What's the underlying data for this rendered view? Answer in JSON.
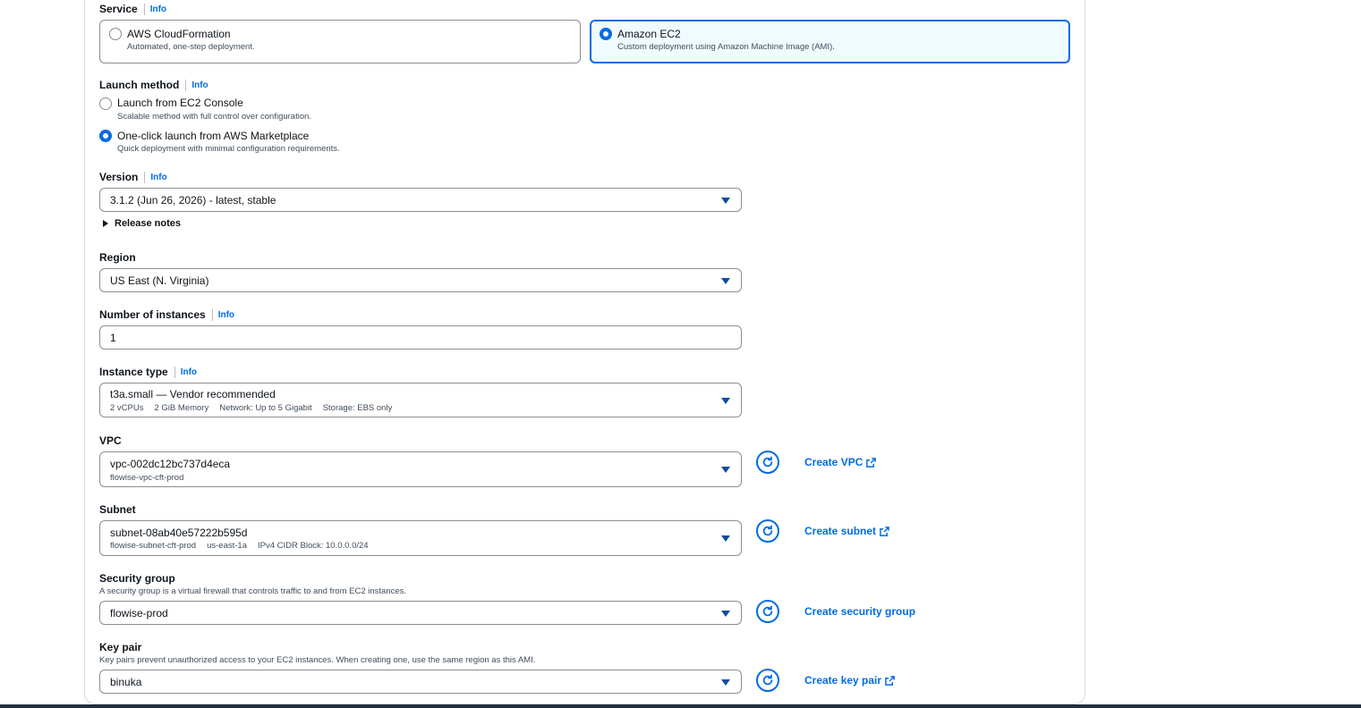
{
  "service": {
    "label": "Service",
    "info": "Info",
    "options": [
      {
        "title": "AWS CloudFormation",
        "desc": "Automated, one-step deployment."
      },
      {
        "title": "Amazon EC2",
        "desc": "Custom deployment using Amazon Machine Image (AMI)."
      }
    ]
  },
  "launch_method": {
    "label": "Launch method",
    "info": "Info",
    "options": [
      {
        "title": "Launch from EC2 Console",
        "desc": "Scalable method with full control over configuration."
      },
      {
        "title": "One-click launch from AWS Marketplace",
        "desc": "Quick deployment with minimal configuration requirements."
      }
    ]
  },
  "version": {
    "label": "Version",
    "info": "Info",
    "value": "3.1.2 (Jun 26, 2026) - latest, stable",
    "release_notes": "Release notes"
  },
  "region": {
    "label": "Region",
    "value": "US East (N. Virginia)"
  },
  "instances": {
    "label": "Number of instances",
    "info": "Info",
    "value": "1"
  },
  "instance_type": {
    "label": "Instance type",
    "info": "Info",
    "value": "t3a.small — Vendor recommended",
    "details": [
      "2 vCPUs",
      "2 GiB Memory",
      "Network: Up to 5 Gigabit",
      "Storage: EBS only"
    ]
  },
  "vpc": {
    "label": "VPC",
    "value": "vpc-002dc12bc737d4eca",
    "sub": "flowise-vpc-cft-prod",
    "create": "Create VPC"
  },
  "subnet": {
    "label": "Subnet",
    "value": "subnet-08ab40e57222b595d",
    "details": [
      "flowise-subnet-cft-prod",
      "us-east-1a",
      "IPv4 CIDR Block: 10.0.0.0/24"
    ],
    "create": "Create subnet"
  },
  "security_group": {
    "label": "Security group",
    "desc": "A security group is a virtual firewall that controls traffic to and from EC2 instances.",
    "value": "flowise-prod",
    "create": "Create security group"
  },
  "key_pair": {
    "label": "Key pair",
    "desc": "Key pairs prevent unauthorized access to your EC2 instances. When creating one, use the same region as this AMI.",
    "value": "binuka",
    "create": "Create key pair"
  },
  "colors": {
    "accent": "#006ce0",
    "border": "#8c8c94",
    "selected_bg": "#f0fbff"
  },
  "icons": {
    "refresh": "refresh-icon",
    "external": "external-link-icon",
    "caret": "caret-down-icon"
  }
}
